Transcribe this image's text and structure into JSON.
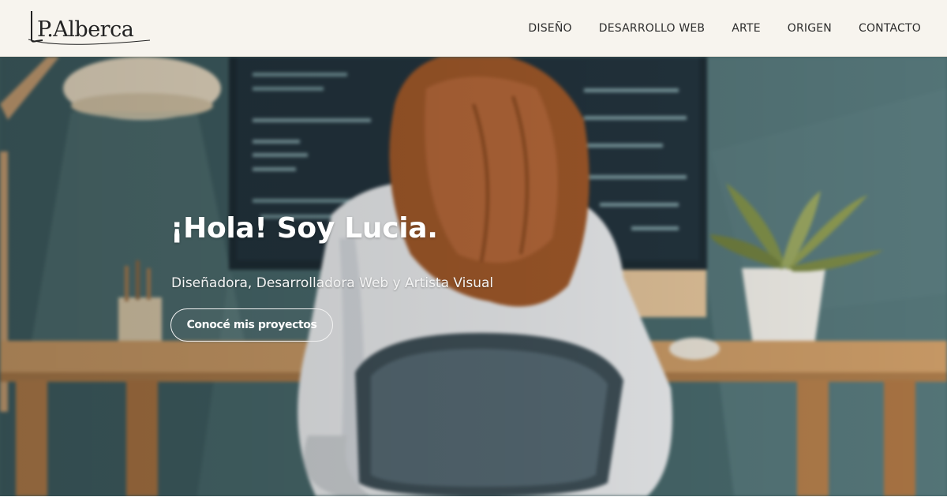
{
  "brand": {
    "logo_text": "LP.Alberca"
  },
  "nav": {
    "items": [
      {
        "label": "DISEÑO"
      },
      {
        "label": "DESARROLLO WEB"
      },
      {
        "label": "ARTE"
      },
      {
        "label": "ORIGEN"
      },
      {
        "label": "CONTACTO"
      }
    ]
  },
  "hero": {
    "title": "¡Hola! Soy Lucia.",
    "subtitle": "Diseñadora, Desarrolladora Web y Artista Visual",
    "cta_label": "Conocé mis proyectos",
    "illustration": "woman-at-desk-coding-illustration"
  },
  "colors": {
    "header_bg": "#f7f4ee",
    "nav_text": "#2c2c2c",
    "wall": "#46676a",
    "desk": "#c99a66",
    "hair": "#a0582a",
    "hero_text": "#ffffff"
  }
}
